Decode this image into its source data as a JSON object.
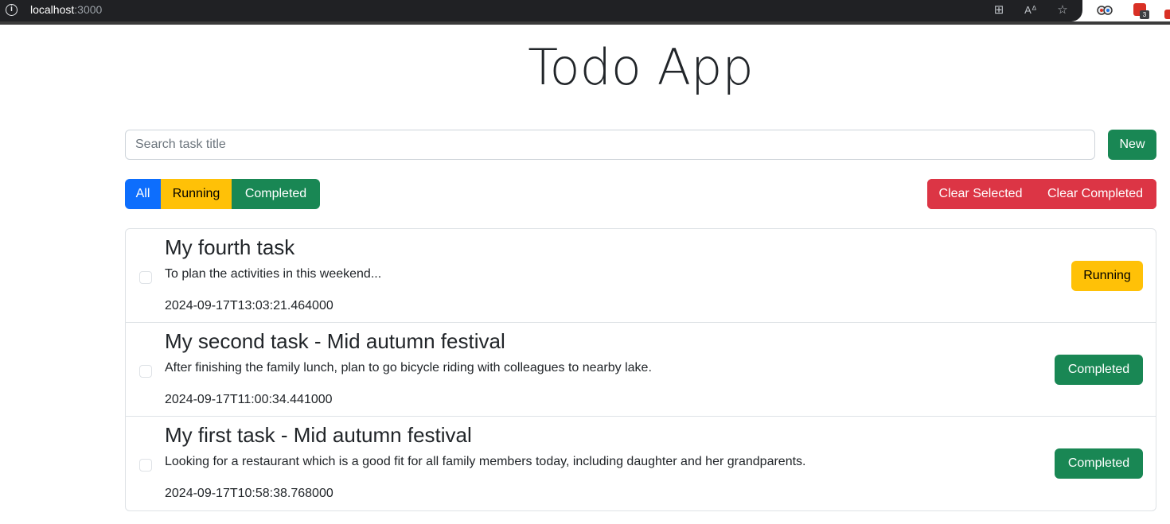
{
  "browser": {
    "url_host": "localhost",
    "url_port": ":3000",
    "ext_badge": "3"
  },
  "app": {
    "title": "Todo App"
  },
  "search": {
    "placeholder": "Search task title",
    "value": ""
  },
  "toolbar": {
    "new_label": "New",
    "filters": [
      "All",
      "Running",
      "Completed"
    ],
    "clear_selected_label": "Clear Selected",
    "clear_completed_label": "Clear Completed"
  },
  "colors": {
    "primary": "#0d6efd",
    "warning": "#ffc107",
    "success": "#198754",
    "danger": "#dc3545"
  },
  "tasks": [
    {
      "title": "My fourth task",
      "description": "To plan the activities in this weekend...",
      "timestamp": "2024-09-17T13:03:21.464000",
      "status": "Running"
    },
    {
      "title": "My second task - Mid autumn festival",
      "description": "After finishing the family lunch, plan to go bicycle riding with colleagues to nearby lake.",
      "timestamp": "2024-09-17T11:00:34.441000",
      "status": "Completed"
    },
    {
      "title": "My first task - Mid autumn festival",
      "description": "Looking for a restaurant which is a good fit for all family members today, including daughter and her grandparents.",
      "timestamp": "2024-09-17T10:58:38.768000",
      "status": "Completed"
    }
  ]
}
